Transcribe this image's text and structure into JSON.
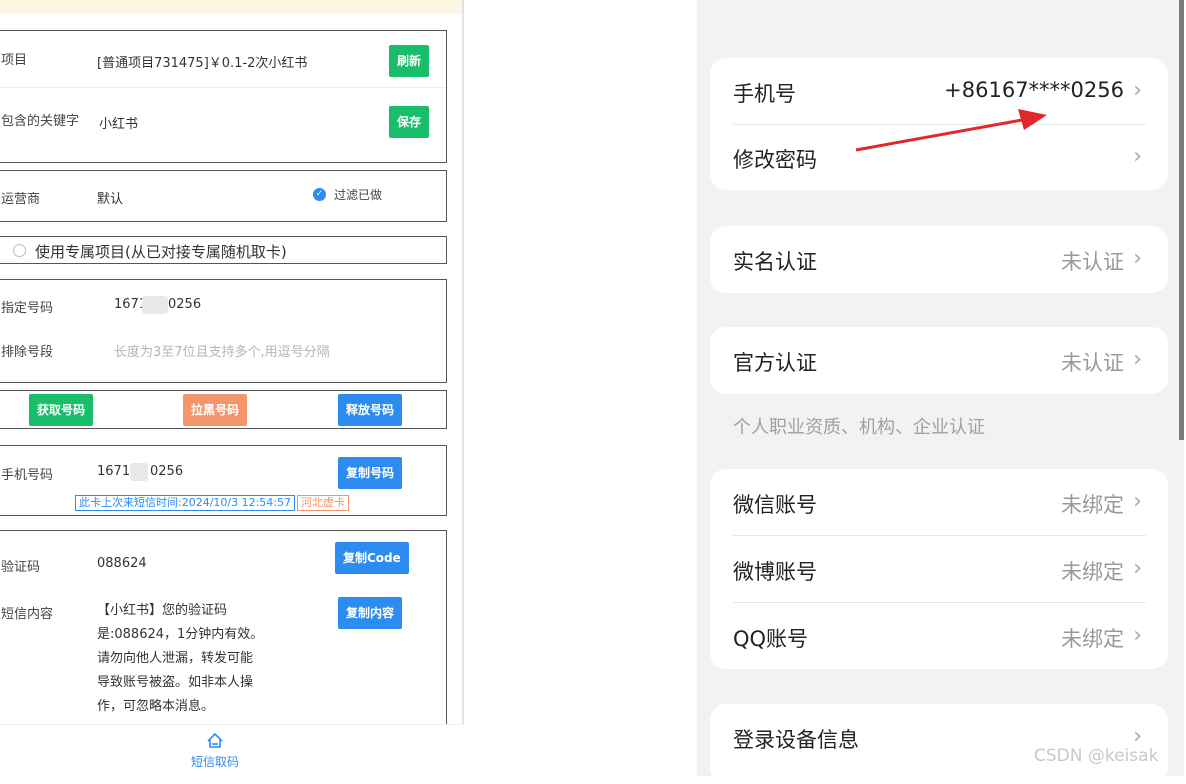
{
  "left_panel": {
    "project": {
      "label": "项目",
      "value": "[普通项目731475]￥0.1-2次小红书",
      "refresh_label": "刷新"
    },
    "keyword": {
      "label": "包含的关键字",
      "value": "小红书",
      "save_label": "保存"
    },
    "carrier": {
      "label": "运营商",
      "value": "默认",
      "filter_label": "过滤已做"
    },
    "exclusive": {
      "label": "使用专属项目(从已对接专属随机取卡)"
    },
    "specify": {
      "label": "指定号码",
      "value_prefix": "1671",
      "value_suffix": "0256"
    },
    "exclude": {
      "label": "排除号段",
      "placeholder": "长度为3至7位且支持多个,用逗号分隔"
    },
    "actions": {
      "get": "获取号码",
      "blacklist": "拉黑号码",
      "release": "释放号码"
    },
    "phone": {
      "label": "手机号码",
      "value_prefix": "1671",
      "value_suffix": "0256",
      "copy_label": "复制号码",
      "last_sms": "此卡上次来短信时间:2024/10/3 12:54:57",
      "region_tag": "河北虚卡"
    },
    "code": {
      "label": "验证码",
      "value": "088624",
      "copy_label": "复制Code"
    },
    "sms": {
      "label": "短信内容",
      "copy_label": "复制内容",
      "lines": [
        "【小红书】您的验证码",
        "是:088624，1分钟内有效。",
        "请勿向他人泄漏，转发可能",
        "导致账号被盗。如非本人操",
        "作，可忽略本消息。"
      ]
    },
    "bottom_nav": {
      "label": "短信取码"
    }
  },
  "phone_panel": {
    "account": {
      "phone_label": "手机号",
      "phone_value": "+86167****0256",
      "password_label": "修改密码"
    },
    "realname": {
      "label": "实名认证",
      "status": "未认证"
    },
    "official": {
      "label": "官方认证",
      "status": "未认证",
      "note": "个人职业资质、机构、企业认证"
    },
    "bindings": [
      {
        "label": "微信账号",
        "status": "未绑定"
      },
      {
        "label": "微博账号",
        "status": "未绑定"
      },
      {
        "label": "QQ账号",
        "status": "未绑定"
      }
    ],
    "device": {
      "label": "登录设备信息"
    }
  },
  "watermark": "CSDN @keisak",
  "colors": {
    "green": "#19be6b",
    "orange": "#f4956b",
    "blue": "#2d8cf0",
    "arrow": "#e0282a"
  }
}
